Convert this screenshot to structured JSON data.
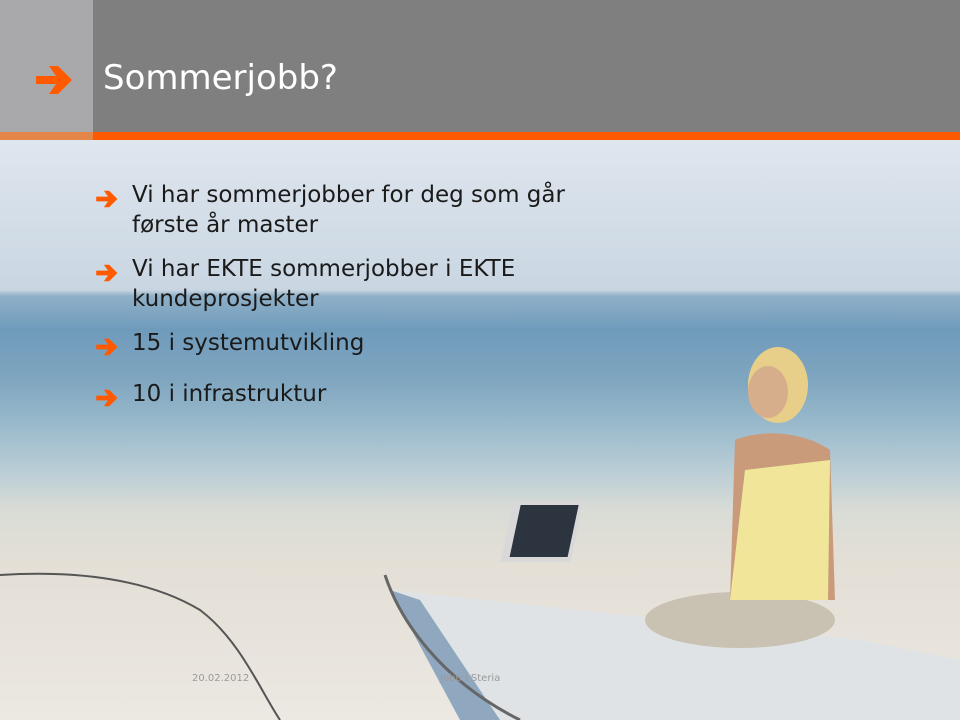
{
  "slide": {
    "title": "Sommerjobb?",
    "bullets": [
      {
        "lines": [
          "Vi har sommerjobber for deg som går",
          "første år master"
        ]
      },
      {
        "lines": [
          "Vi har EKTE sommerjobber i EKTE",
          "kundeprosjekter"
        ]
      },
      {
        "lines": [
          "15 i systemutvikling"
        ]
      },
      {
        "lines": [
          "10 i infrastruktur"
        ]
      }
    ],
    "footer": {
      "date": "20.02.2012",
      "text": "Jobb i Steria"
    }
  },
  "colors": {
    "accent": "#ff5a00",
    "header": "#7f7f7f",
    "header_left": "#a9a9ab"
  }
}
